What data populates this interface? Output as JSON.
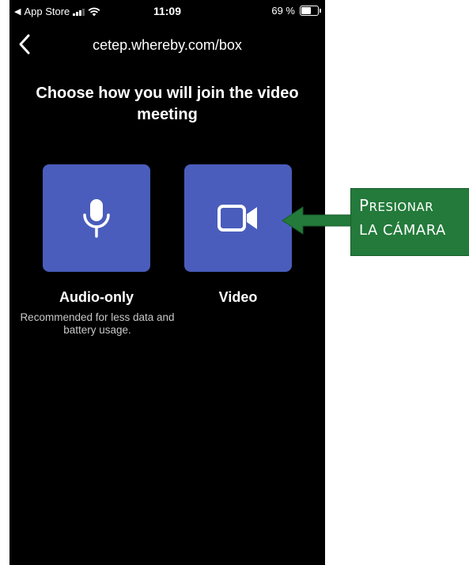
{
  "status_bar": {
    "back_app": "App Store",
    "time": "11:09",
    "battery_percent": "69 %",
    "battery_level": 0.69
  },
  "nav": {
    "title": "cetep.whereby.com/box",
    "back_icon": "chevron-left-icon"
  },
  "heading": "Choose how you will join the video meeting",
  "options": [
    {
      "icon": "microphone-icon",
      "label": "Audio-only",
      "description": "Recommended for less data and battery usage."
    },
    {
      "icon": "video-camera-icon",
      "label": "Video",
      "description": ""
    }
  ],
  "annotation": {
    "line1": "Presionar",
    "line2": "la cámara",
    "color": "#237a3a"
  },
  "colors": {
    "tile": "#4a5dbc",
    "background": "#000000"
  }
}
